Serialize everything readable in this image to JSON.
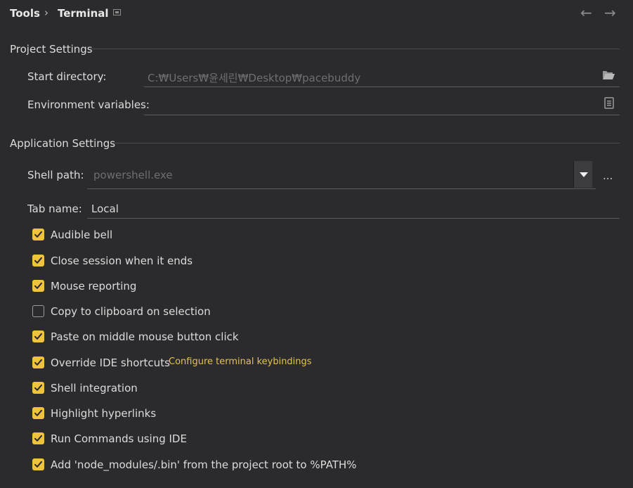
{
  "breadcrumb": {
    "parent": "Tools",
    "separator": "›",
    "current": "Terminal"
  },
  "nav": {
    "back": "←",
    "forward": "→"
  },
  "project_settings": {
    "title": "Project Settings",
    "start_directory_label": "Start directory:",
    "start_directory_value": "C:₩Users₩윤세린₩Desktop₩pacebuddy",
    "env_vars_label": "Environment variables:",
    "env_vars_value": ""
  },
  "application_settings": {
    "title": "Application Settings",
    "shell_path_label": "Shell path:",
    "shell_path_placeholder": "powershell.exe",
    "shell_browse": "...",
    "tab_name_label": "Tab name:",
    "tab_name_value": "Local",
    "checkboxes": [
      {
        "label": "Audible bell",
        "checked": true
      },
      {
        "label": "Close session when it ends",
        "checked": true
      },
      {
        "label": "Mouse reporting",
        "checked": true
      },
      {
        "label": "Copy to clipboard on selection",
        "checked": false
      },
      {
        "label": "Paste on middle mouse button click",
        "checked": true
      },
      {
        "label": "Override IDE shortcuts",
        "checked": true
      },
      {
        "label": "Shell integration",
        "checked": true
      },
      {
        "label": "Highlight hyperlinks",
        "checked": true
      },
      {
        "label": "Run Commands using IDE",
        "checked": true
      },
      {
        "label": "Add 'node_modules/.bin' from the project root to %PATH%",
        "checked": true
      }
    ],
    "configure_keybindings_link": "Configure terminal keybindings"
  },
  "icons": {
    "pin": "pin-icon",
    "folder": "folder-open-icon",
    "document": "document-icon",
    "dropdown": "chevron-down-icon",
    "back": "arrow-left-icon",
    "forward": "arrow-right-icon",
    "check": "checkmark-icon"
  },
  "colors": {
    "background": "#2b2b2e",
    "accent": "#f0c33c",
    "link": "#e5c34a"
  }
}
